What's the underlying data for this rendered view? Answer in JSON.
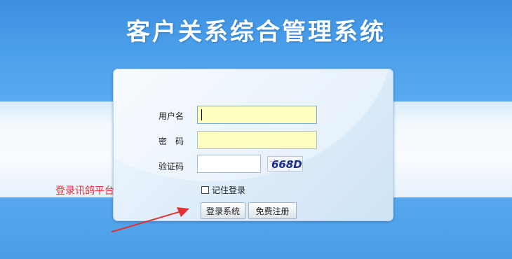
{
  "page": {
    "title": "客户关系综合管理系统"
  },
  "login_form": {
    "username_label": "用户名",
    "username_value": "",
    "password_label": "密　码",
    "password_value": "",
    "captcha_label": "验证码",
    "captcha_value": "",
    "captcha_image_text": "668D",
    "remember_label": "记住登录",
    "remember_checked": false,
    "login_button": "登录系统",
    "register_button": "免费注册"
  },
  "annotation": {
    "text": "登录讯鸽平台",
    "color": "#e03232"
  },
  "colors": {
    "background_blue": "#4a9ee6",
    "input_highlight": "#ffffc0",
    "title_text": "#ffffff"
  }
}
